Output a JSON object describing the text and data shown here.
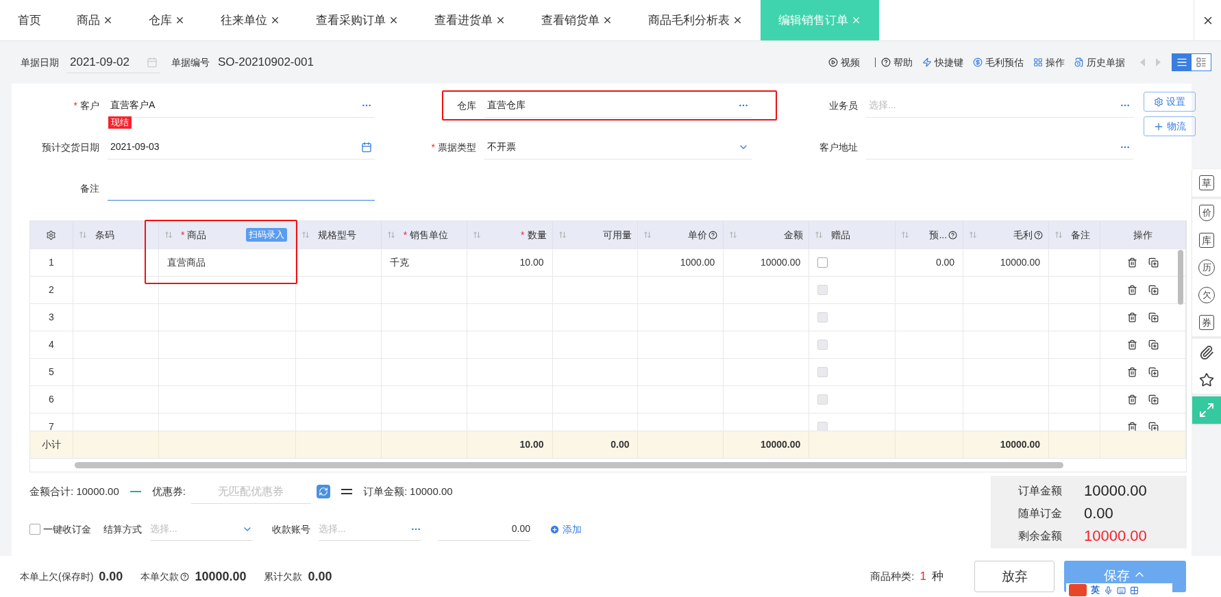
{
  "tabs": [
    {
      "label": "首页",
      "closable": false,
      "selected": false
    },
    {
      "label": "商品",
      "closable": true,
      "selected": false
    },
    {
      "label": "仓库",
      "closable": true,
      "selected": false
    },
    {
      "label": "往来单位",
      "closable": true,
      "selected": false
    },
    {
      "label": "查看采购订单",
      "closable": true,
      "selected": false
    },
    {
      "label": "查看进货单",
      "closable": true,
      "selected": false
    },
    {
      "label": "查看销货单",
      "closable": true,
      "selected": false
    },
    {
      "label": "商品毛利分析表",
      "closable": true,
      "selected": false
    },
    {
      "label": "编辑销售订单",
      "closable": true,
      "selected": true
    }
  ],
  "header": {
    "date_label": "单据日期",
    "date": "2021-09-02",
    "number_label": "单据编号",
    "number": "SO-20210902-001",
    "toolbar": [
      {
        "label": "视频",
        "kind": "video"
      },
      {
        "label": "帮助",
        "kind": "help"
      },
      {
        "label": "快捷键",
        "kind": "shortcut"
      },
      {
        "label": "毛利预估",
        "kind": "profit"
      },
      {
        "label": "操作",
        "kind": "operate"
      },
      {
        "label": "历史单据",
        "kind": "history"
      }
    ],
    "view_modes": [
      {
        "kind": "list",
        "selected": true
      },
      {
        "kind": "detail",
        "selected": false
      }
    ]
  },
  "form": {
    "fields": [
      {
        "label": "客户",
        "required_mark": "*",
        "value": "直营客户A",
        "kind": "dots",
        "tag": "现结",
        "highlighted": false
      },
      {
        "label": "仓库",
        "value": "直营仓库",
        "kind": "dots",
        "highlighted": true
      },
      {
        "label": "业务员",
        "placeholder": "选择...",
        "kind": "dots",
        "highlighted": false
      },
      {
        "label": "预计交货日期",
        "value": "2021-09-03",
        "kind": "calendar",
        "highlighted": false
      },
      {
        "label": "票据类型",
        "required_mark": "*",
        "value": "不开票",
        "kind": "select",
        "highlighted": false
      },
      {
        "label": "客户地址",
        "kind": "dots",
        "highlighted": false
      }
    ],
    "note": {
      "label": "备注",
      "focused": true
    },
    "buttons": [
      {
        "label": "设置",
        "kind": "settings"
      },
      {
        "label": "物流",
        "kind": "add"
      }
    ]
  },
  "table": {
    "columns": [
      {
        "kind": "index"
      },
      {
        "label": "条码",
        "kind": "text",
        "help": false,
        "highlighted": false
      },
      {
        "label": "商品",
        "kind": "text",
        "required_mark": "*",
        "help": false,
        "badge": "扫码录入",
        "highlighted": true
      },
      {
        "label": "规格型号",
        "kind": "text",
        "help": false,
        "highlighted": false
      },
      {
        "label": "销售单位",
        "kind": "text",
        "required_mark": "*",
        "help": false,
        "highlighted": false
      },
      {
        "label": "数量",
        "kind": "number",
        "required_mark": "*",
        "help": false,
        "highlighted": false
      },
      {
        "label": "可用量",
        "kind": "number",
        "help": false,
        "highlighted": false
      },
      {
        "label": "单价",
        "kind": "number",
        "help": true,
        "highlighted": false
      },
      {
        "label": "金额",
        "kind": "number",
        "help": false,
        "highlighted": false
      },
      {
        "label": "赠品",
        "kind": "checkbox",
        "help": false,
        "highlighted": false
      },
      {
        "label": "预...",
        "kind": "number",
        "help": true,
        "highlighted": false
      },
      {
        "label": "毛利",
        "kind": "number",
        "help": true,
        "highlighted": false
      },
      {
        "label": "备注",
        "kind": "text",
        "help": false,
        "highlighted": false
      },
      {
        "label": "操作",
        "kind": "actions"
      }
    ],
    "rows": [
      {
        "cells": [
          "1",
          "",
          "直营商品",
          "",
          "千克",
          "10.00",
          "",
          "1000.00",
          "10000.00",
          {
            "checked": false,
            "disabled": false
          },
          "0.00",
          "10000.00",
          ""
        ]
      },
      {
        "cells": [
          "2",
          "",
          "",
          "",
          "",
          "",
          "",
          "",
          "",
          {
            "checked": false,
            "disabled": true
          },
          "",
          "",
          ""
        ]
      },
      {
        "cells": [
          "3",
          "",
          "",
          "",
          "",
          "",
          "",
          "",
          "",
          {
            "checked": false,
            "disabled": true
          },
          "",
          "",
          ""
        ]
      },
      {
        "cells": [
          "4",
          "",
          "",
          "",
          "",
          "",
          "",
          "",
          "",
          {
            "checked": false,
            "disabled": true
          },
          "",
          "",
          ""
        ]
      },
      {
        "cells": [
          "5",
          "",
          "",
          "",
          "",
          "",
          "",
          "",
          "",
          {
            "checked": false,
            "disabled": true
          },
          "",
          "",
          ""
        ]
      },
      {
        "cells": [
          "6",
          "",
          "",
          "",
          "",
          "",
          "",
          "",
          "",
          {
            "checked": false,
            "disabled": true
          },
          "",
          "",
          ""
        ]
      },
      {
        "cells": [
          "7",
          "",
          "",
          "",
          "",
          "",
          "",
          "",
          "",
          {
            "checked": false,
            "disabled": true
          },
          "",
          "",
          ""
        ]
      }
    ],
    "subtotal": {
      "cells": [
        "小计",
        "",
        "",
        "",
        "",
        "10.00",
        "0.00",
        "",
        "10000.00",
        "",
        "",
        "10000.00",
        ""
      ]
    }
  },
  "summary": {
    "total_label": "金额合计:",
    "total": "10000.00",
    "coupon_label": "优惠券:",
    "coupon_placeholder": "无匹配优惠券",
    "order_label": "订单金额:",
    "order_total": "10000.00",
    "deposit_check": {
      "label": "一键收订金",
      "checked": false
    },
    "settle_label": "结算方式",
    "settle_placeholder": "选择...",
    "account_label": "收款账号",
    "account_placeholder": "选择...",
    "amount": "0.00",
    "add_label": "添加",
    "panel": [
      {
        "label": "订单金额",
        "value": "10000.00",
        "alert": false
      },
      {
        "label": "随单订金",
        "value": "0.00",
        "alert": false
      },
      {
        "label": "剩余金额",
        "value": "10000.00",
        "alert": true
      }
    ]
  },
  "footer": {
    "items": [
      {
        "label": "本单上欠(保存时)",
        "value": "0.00",
        "help": false
      },
      {
        "label": "本单欠款",
        "value": "10000.00",
        "help": true
      },
      {
        "label": "累计欠款",
        "value": "0.00",
        "help": false
      }
    ],
    "kinds_label": "商品种类:",
    "kinds_count": "1",
    "kinds_unit": "种",
    "discard": "放弃",
    "save": "保存"
  },
  "side_toolbar": [
    {
      "kind": "doc",
      "glyph": "草",
      "selected": false
    },
    {
      "kind": "shield",
      "glyph": "价",
      "selected": false
    },
    {
      "kind": "box",
      "glyph": "库",
      "selected": false
    },
    {
      "kind": "cycle",
      "glyph": "历",
      "selected": false
    },
    {
      "kind": "circle",
      "glyph": "欠",
      "selected": false
    },
    {
      "kind": "box",
      "glyph": "券",
      "selected": false
    },
    {
      "kind": "clip",
      "selected": false
    },
    {
      "kind": "star",
      "selected": false
    },
    {
      "kind": "expand",
      "selected": true
    }
  ],
  "ime": {
    "label": "英"
  }
}
